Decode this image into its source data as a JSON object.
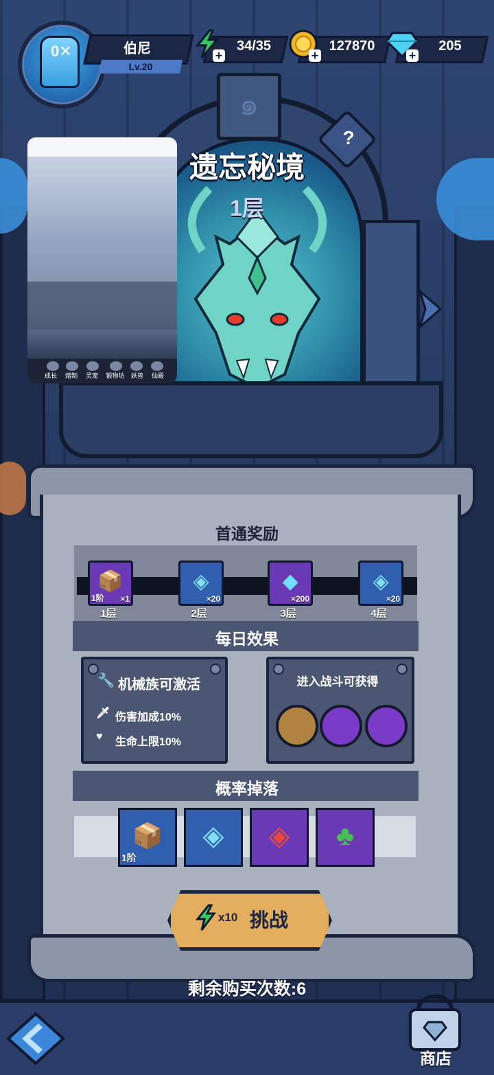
{
  "player": {
    "name": "伯尼",
    "level": "Lv.20"
  },
  "resources": {
    "energy": "34/35",
    "gold": "127870",
    "gems": "205"
  },
  "dungeon": {
    "title": "遗忘秘境",
    "floor": "1层",
    "help": "?"
  },
  "video_preview": {
    "tabs": [
      "成长",
      "熔制",
      "灵宠",
      "锻物坊",
      "妖兽",
      "仙殿"
    ]
  },
  "first_clear": {
    "title": "首通奖励",
    "rewards": [
      {
        "tag": "1阶",
        "count": "×1",
        "label": "1层"
      },
      {
        "tag": "",
        "count": "×20",
        "label": "2层"
      },
      {
        "tag": "",
        "count": "×200",
        "label": "3层"
      },
      {
        "tag": "",
        "count": "×20",
        "label": "4层"
      }
    ]
  },
  "daily": {
    "title": "每日效果",
    "left_title": "机械族可激活",
    "effects": [
      "伤害加成10%",
      "生命上限10%"
    ],
    "right_title": "进入战斗可获得"
  },
  "drops": {
    "title": "概率掉落",
    "first_tag": "1阶"
  },
  "challenge": {
    "cost": "x10",
    "label": "挑战"
  },
  "remaining": "剩余购买次数:6",
  "shop": "商店",
  "icons": {
    "energy": "lightning-icon",
    "gold": "gold-coin-icon",
    "gem": "diamond-icon"
  }
}
